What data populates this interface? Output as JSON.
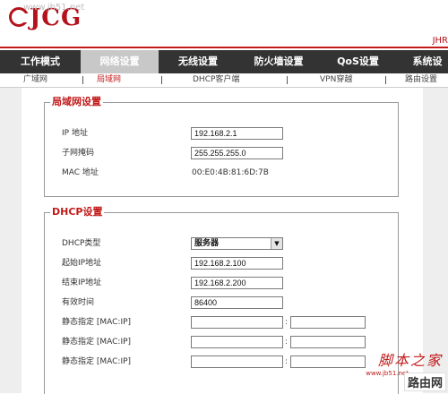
{
  "header": {
    "logo_text": "JCG",
    "watermark": "www.jb51.net",
    "model": "JHR"
  },
  "nav": {
    "tabs": [
      {
        "label": "工作模式"
      },
      {
        "label": "网络设置"
      },
      {
        "label": "无线设置"
      },
      {
        "label": "防火墙设置"
      },
      {
        "label": "QoS设置"
      },
      {
        "label": "系统设"
      }
    ],
    "active_index": 1
  },
  "subnav": {
    "items": [
      {
        "label": "广域网"
      },
      {
        "label": "局域网"
      },
      {
        "label": "DHCP客户端"
      },
      {
        "label": "VPN穿越"
      },
      {
        "label": "路由设置"
      }
    ],
    "active_index": 1
  },
  "lan": {
    "legend": "局域网设置",
    "ip_label": "IP 地址",
    "ip_value": "192.168.2.1",
    "mask_label": "子网掩码",
    "mask_value": "255.255.255.0",
    "mac_label": "MAC 地址",
    "mac_value": "00:E0:4B:81:6D:7B"
  },
  "dhcp": {
    "legend": "DHCP设置",
    "type_label": "DHCP类型",
    "type_value": "服务器",
    "start_label": "起始IP地址",
    "start_value": "192.168.2.100",
    "end_label": "结束IP地址",
    "end_value": "192.168.2.200",
    "lease_label": "有效时间",
    "lease_value": "86400",
    "static_rows": [
      {
        "label": "静态指定 [MAC:IP]",
        "mac": "",
        "ip": "",
        "sep": ":"
      },
      {
        "label": "静态指定 [MAC:IP]",
        "mac": "",
        "ip": "",
        "sep": ":"
      },
      {
        "label": "静态指定 [MAC:IP]",
        "mac": "",
        "ip": "",
        "sep": ":"
      }
    ]
  },
  "overlay": {
    "badge": "脚本之家",
    "url": "www.jb51.net",
    "corner": "路由网"
  },
  "colors": {
    "brand_red": "#c21a1a",
    "nav_bg": "#333333",
    "nav_active": "#c8c8c8"
  }
}
